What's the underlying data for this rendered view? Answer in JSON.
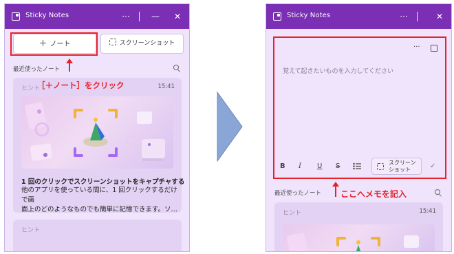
{
  "left_window": {
    "title": "Sticky Notes",
    "titlebar_buttons": [
      "···",
      "—",
      "✕"
    ],
    "new_note_label": "ノート",
    "screenshot_label": "スクリーンショット",
    "recent_label": "最近使ったノート",
    "annotation": "［＋ノート］をクリック",
    "card1": {
      "hint": "ヒント",
      "time": "15:41",
      "title": "1 回のクリックでスクリーンショットをキャプチャする",
      "body_line1": "他のアプリを使っている間に、1 回クリックするだけで画",
      "body_line2": "面上のどのようなものでも簡単に記憶できます。ソ…"
    },
    "card2": {
      "hint": "ヒント"
    }
  },
  "right_window": {
    "title": "Sticky Notes",
    "titlebar_buttons": [
      "···",
      "✕"
    ],
    "editor_menu": "···",
    "placeholder": "覚えて起きたいものを入力してください",
    "format_bold": "B",
    "format_italic": "I",
    "format_underline": "U",
    "format_strike": "S",
    "screenshot_line1": "スクリーン",
    "screenshot_line2": "ショット",
    "confirm": "✓",
    "recent_label": "最近使ったノート",
    "annotation": "ここへメモを記入",
    "card": {
      "hint": "ヒント",
      "time": "15:41"
    }
  },
  "colors": {
    "titlebar": "#7a2fb5",
    "annotation_red": "#e8202a",
    "arrow_blue": "#8aa6d6"
  },
  "icons": [
    "sticky-notes-app-icon",
    "plus-icon",
    "screenshot-icon",
    "search-icon",
    "expand-icon",
    "list-icon",
    "check-icon",
    "chevron-right-arrow"
  ]
}
